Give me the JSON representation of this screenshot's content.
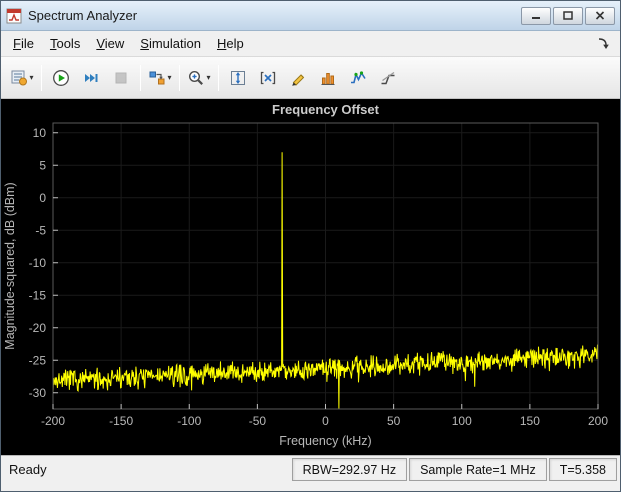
{
  "window": {
    "title": "Spectrum Analyzer"
  },
  "titlebar_controls": {
    "minimize": "minimize",
    "maximize": "maximize",
    "close": "close"
  },
  "menu": {
    "items": [
      {
        "label": "File"
      },
      {
        "label": "Tools"
      },
      {
        "label": "View"
      },
      {
        "label": "Simulation"
      },
      {
        "label": "Help"
      }
    ]
  },
  "icons": {
    "dropdown": "▾"
  },
  "toolbar": {
    "buttons": [
      "configuration-properties",
      "run",
      "step-forward",
      "stop",
      "simulation-settings",
      "zoom",
      "scale-axes",
      "cursor-measurements",
      "signal-statistics",
      "peak-finder",
      "distortion-measurements",
      "spectral-mask"
    ]
  },
  "status": {
    "ready": "Ready",
    "cells": [
      "RBW=292.97 Hz",
      "Sample Rate=1 MHz",
      "T=5.358"
    ]
  },
  "chart_data": {
    "type": "line",
    "title": "Frequency Offset",
    "xlabel": "Frequency (kHz)",
    "ylabel": "Magnitude-squared, dB (dBm)",
    "xlim": [
      -200,
      200
    ],
    "ylim": [
      -32.5,
      11.5
    ],
    "xticks": [
      -200,
      -150,
      -100,
      -50,
      0,
      50,
      100,
      150,
      200
    ],
    "yticks": [
      10,
      5,
      0,
      -5,
      -10,
      -15,
      -20,
      -25,
      -30
    ],
    "background": "#000000",
    "axis_color": "#b8b8b8",
    "grid": false,
    "legend": "none",
    "series": [
      {
        "name": "spectrum-trace",
        "color": "#ffff00",
        "noise_floor_start_dbm": -28.2,
        "noise_floor_end_dbm": -24.2,
        "noise_peak_to_peak_db": 2.6,
        "tone_frequency_khz": -32,
        "tone_peak_dbm": 7,
        "dip_frequency_khz": 10,
        "dip_dbm": -33,
        "num_points": 1000,
        "seed": 7
      }
    ]
  }
}
